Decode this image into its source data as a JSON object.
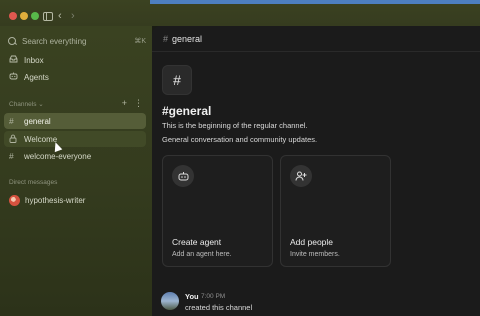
{
  "window": {
    "nav_back": "‹",
    "nav_forward": "›"
  },
  "sidebar": {
    "search_placeholder": "Search everything",
    "search_shortcut": "⌘K",
    "top_items": [
      {
        "label": "Inbox",
        "icon": "inbox-icon"
      },
      {
        "label": "Agents",
        "icon": "robot-icon"
      }
    ],
    "channels_label": "Channels",
    "channels_chevron": "⌄",
    "add_symbol": "+",
    "more_symbol": "⋮",
    "channels": [
      {
        "label": "general",
        "icon": "#",
        "selected": true
      },
      {
        "label": "Welcome",
        "icon": "lock-icon",
        "hovered": true
      },
      {
        "label": "welcome-everyone",
        "icon": "#"
      }
    ],
    "dm_label": "Direct messages",
    "direct_messages": [
      {
        "label": "hypothesis-writer"
      }
    ]
  },
  "main": {
    "header_hash": "#",
    "header_title": "general",
    "big_hash": "#",
    "channel_title": "#general",
    "intro_text": "This is the beginning of the regular channel.",
    "description": "General conversation and community updates.",
    "cards": [
      {
        "icon": "robot-icon",
        "glyph": "⊡",
        "title": "Create agent",
        "subtitle": "Add an agent here."
      },
      {
        "icon": "add-user-icon",
        "glyph": "⚇",
        "title": "Add people",
        "subtitle": "Invite members."
      }
    ],
    "message": {
      "author": "You",
      "time": "7:00 PM",
      "text": "created this channel"
    }
  },
  "colors": {
    "sidebar_bg": "#3a4221",
    "main_bg": "#1b1b1b",
    "selected_channel": "#555d38",
    "accent_strip": "#4d7fc0"
  }
}
